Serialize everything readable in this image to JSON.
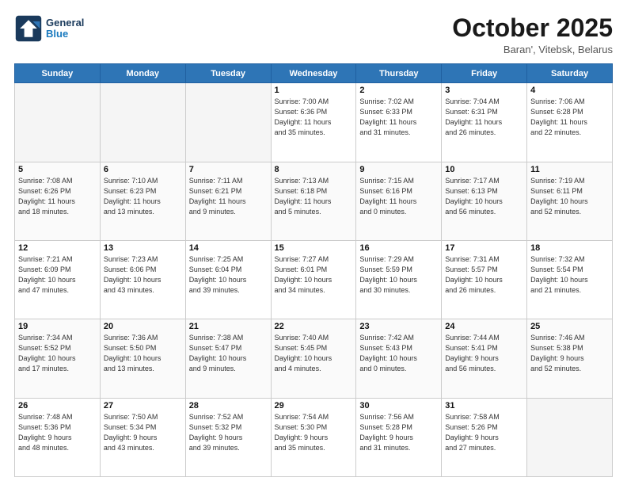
{
  "header": {
    "logo_line1": "General",
    "logo_line2": "Blue",
    "month": "October 2025",
    "location": "Baran', Vitebsk, Belarus"
  },
  "weekdays": [
    "Sunday",
    "Monday",
    "Tuesday",
    "Wednesday",
    "Thursday",
    "Friday",
    "Saturday"
  ],
  "weeks": [
    [
      {
        "day": "",
        "info": ""
      },
      {
        "day": "",
        "info": ""
      },
      {
        "day": "",
        "info": ""
      },
      {
        "day": "1",
        "info": "Sunrise: 7:00 AM\nSunset: 6:36 PM\nDaylight: 11 hours\nand 35 minutes."
      },
      {
        "day": "2",
        "info": "Sunrise: 7:02 AM\nSunset: 6:33 PM\nDaylight: 11 hours\nand 31 minutes."
      },
      {
        "day": "3",
        "info": "Sunrise: 7:04 AM\nSunset: 6:31 PM\nDaylight: 11 hours\nand 26 minutes."
      },
      {
        "day": "4",
        "info": "Sunrise: 7:06 AM\nSunset: 6:28 PM\nDaylight: 11 hours\nand 22 minutes."
      }
    ],
    [
      {
        "day": "5",
        "info": "Sunrise: 7:08 AM\nSunset: 6:26 PM\nDaylight: 11 hours\nand 18 minutes."
      },
      {
        "day": "6",
        "info": "Sunrise: 7:10 AM\nSunset: 6:23 PM\nDaylight: 11 hours\nand 13 minutes."
      },
      {
        "day": "7",
        "info": "Sunrise: 7:11 AM\nSunset: 6:21 PM\nDaylight: 11 hours\nand 9 minutes."
      },
      {
        "day": "8",
        "info": "Sunrise: 7:13 AM\nSunset: 6:18 PM\nDaylight: 11 hours\nand 5 minutes."
      },
      {
        "day": "9",
        "info": "Sunrise: 7:15 AM\nSunset: 6:16 PM\nDaylight: 11 hours\nand 0 minutes."
      },
      {
        "day": "10",
        "info": "Sunrise: 7:17 AM\nSunset: 6:13 PM\nDaylight: 10 hours\nand 56 minutes."
      },
      {
        "day": "11",
        "info": "Sunrise: 7:19 AM\nSunset: 6:11 PM\nDaylight: 10 hours\nand 52 minutes."
      }
    ],
    [
      {
        "day": "12",
        "info": "Sunrise: 7:21 AM\nSunset: 6:09 PM\nDaylight: 10 hours\nand 47 minutes."
      },
      {
        "day": "13",
        "info": "Sunrise: 7:23 AM\nSunset: 6:06 PM\nDaylight: 10 hours\nand 43 minutes."
      },
      {
        "day": "14",
        "info": "Sunrise: 7:25 AM\nSunset: 6:04 PM\nDaylight: 10 hours\nand 39 minutes."
      },
      {
        "day": "15",
        "info": "Sunrise: 7:27 AM\nSunset: 6:01 PM\nDaylight: 10 hours\nand 34 minutes."
      },
      {
        "day": "16",
        "info": "Sunrise: 7:29 AM\nSunset: 5:59 PM\nDaylight: 10 hours\nand 30 minutes."
      },
      {
        "day": "17",
        "info": "Sunrise: 7:31 AM\nSunset: 5:57 PM\nDaylight: 10 hours\nand 26 minutes."
      },
      {
        "day": "18",
        "info": "Sunrise: 7:32 AM\nSunset: 5:54 PM\nDaylight: 10 hours\nand 21 minutes."
      }
    ],
    [
      {
        "day": "19",
        "info": "Sunrise: 7:34 AM\nSunset: 5:52 PM\nDaylight: 10 hours\nand 17 minutes."
      },
      {
        "day": "20",
        "info": "Sunrise: 7:36 AM\nSunset: 5:50 PM\nDaylight: 10 hours\nand 13 minutes."
      },
      {
        "day": "21",
        "info": "Sunrise: 7:38 AM\nSunset: 5:47 PM\nDaylight: 10 hours\nand 9 minutes."
      },
      {
        "day": "22",
        "info": "Sunrise: 7:40 AM\nSunset: 5:45 PM\nDaylight: 10 hours\nand 4 minutes."
      },
      {
        "day": "23",
        "info": "Sunrise: 7:42 AM\nSunset: 5:43 PM\nDaylight: 10 hours\nand 0 minutes."
      },
      {
        "day": "24",
        "info": "Sunrise: 7:44 AM\nSunset: 5:41 PM\nDaylight: 9 hours\nand 56 minutes."
      },
      {
        "day": "25",
        "info": "Sunrise: 7:46 AM\nSunset: 5:38 PM\nDaylight: 9 hours\nand 52 minutes."
      }
    ],
    [
      {
        "day": "26",
        "info": "Sunrise: 7:48 AM\nSunset: 5:36 PM\nDaylight: 9 hours\nand 48 minutes."
      },
      {
        "day": "27",
        "info": "Sunrise: 7:50 AM\nSunset: 5:34 PM\nDaylight: 9 hours\nand 43 minutes."
      },
      {
        "day": "28",
        "info": "Sunrise: 7:52 AM\nSunset: 5:32 PM\nDaylight: 9 hours\nand 39 minutes."
      },
      {
        "day": "29",
        "info": "Sunrise: 7:54 AM\nSunset: 5:30 PM\nDaylight: 9 hours\nand 35 minutes."
      },
      {
        "day": "30",
        "info": "Sunrise: 7:56 AM\nSunset: 5:28 PM\nDaylight: 9 hours\nand 31 minutes."
      },
      {
        "day": "31",
        "info": "Sunrise: 7:58 AM\nSunset: 5:26 PM\nDaylight: 9 hours\nand 27 minutes."
      },
      {
        "day": "",
        "info": ""
      }
    ]
  ]
}
